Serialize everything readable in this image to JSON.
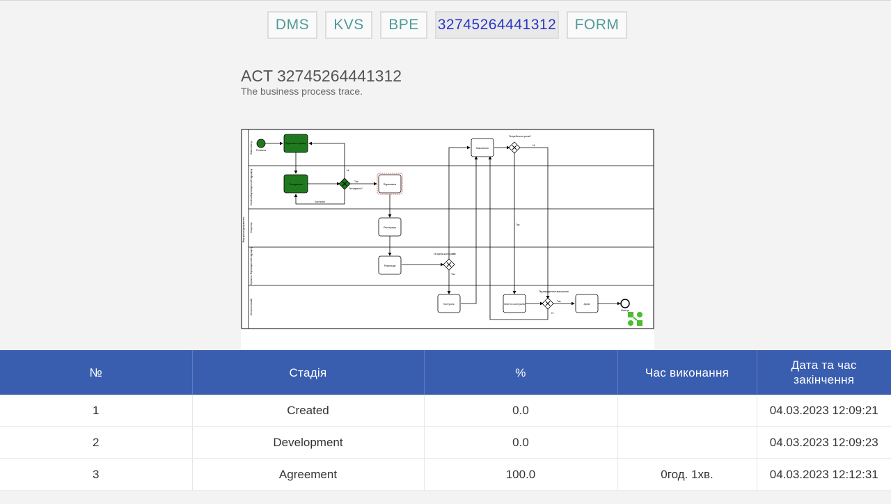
{
  "nav": {
    "tabs": [
      {
        "label": "DMS",
        "active": false
      },
      {
        "label": "KVS",
        "active": false
      },
      {
        "label": "BPE",
        "active": false
      },
      {
        "label": "32745264441312",
        "active": true
      },
      {
        "label": "FORM",
        "active": false
      }
    ]
  },
  "header": {
    "title": "ACT 32745264441312",
    "subtitle": "The business process trace."
  },
  "diagram": {
    "lanes": {
      "outer": "Внутрішні документи",
      "l1": "Виконавець",
      "l2": "Керівник/Відповідальний підрозділу",
      "l3": "Секретар",
      "l4": "Керівник / Відповідальний підрозділу",
      "l5": "Контролюючий"
    },
    "nodes": {
      "start": "Початок",
      "prepare": "Підготовка проекту",
      "approve": "Погодження",
      "sign": "Підписання",
      "register": "Реєстрація",
      "resolution": "Резолюція",
      "control": "Контроль",
      "execution": "Виконання",
      "remove": "Зняття з контролю",
      "archive": "Архів",
      "end": "Кінець"
    },
    "labels": {
      "agreed": "Погоджено?",
      "yes": "Так",
      "no": "Ні",
      "partial": "Частково",
      "need_control_1": "Потреба контролю?",
      "need_control_2": "Потреба контролю?",
      "confirm_exec": "Підтвердження виконання"
    },
    "colors": {
      "done": "#1f7a1f",
      "current_border": "#e07070"
    }
  },
  "table": {
    "headers": [
      "№",
      "Стадія",
      "%",
      "Час виконання",
      "Дата та час закінчення"
    ],
    "rows": [
      [
        "1",
        "Created",
        "0.0",
        "",
        "04.03.2023 12:09:21"
      ],
      [
        "2",
        "Development",
        "0.0",
        "",
        "04.03.2023 12:09:23"
      ],
      [
        "3",
        "Agreement",
        "100.0",
        "0год. 1хв.",
        "04.03.2023 12:12:31"
      ]
    ]
  }
}
